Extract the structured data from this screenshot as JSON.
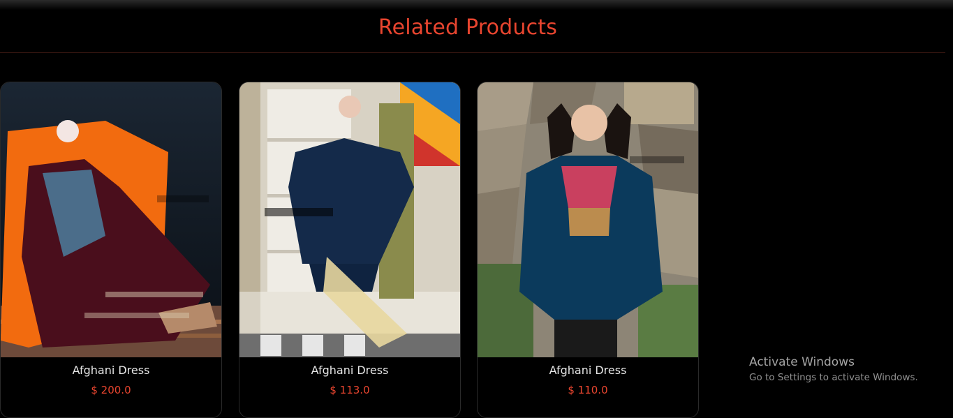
{
  "section": {
    "title": "Related Products"
  },
  "products": [
    {
      "name": "Afghani Dress",
      "price": "$ 200.0",
      "image_watermark": "@JAMADESIGNINGCENTER"
    },
    {
      "name": "Afghani Dress",
      "price": "$ 113.0",
      "image_watermark": "@JAMADESIGNINGCENTER"
    },
    {
      "name": "Afghani Dress",
      "price": "$ 110.0",
      "image_watermark": "@JAMADESIGNINGCENTER"
    }
  ],
  "os_watermark": {
    "title": "Activate Windows",
    "subtitle": "Go to Settings to activate Windows."
  },
  "colors": {
    "accent": "#e8452f",
    "background": "#000000",
    "text": "#e6e6e6"
  }
}
